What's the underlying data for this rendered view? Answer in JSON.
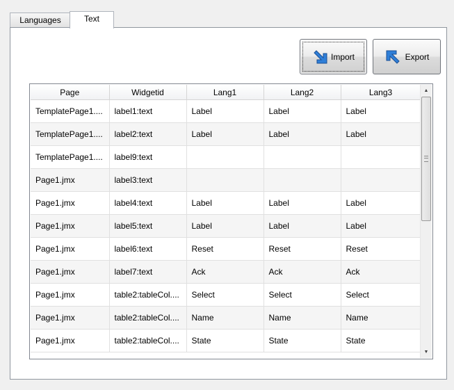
{
  "tabs": [
    {
      "label": "Languages",
      "active": false
    },
    {
      "label": "Text",
      "active": true
    }
  ],
  "buttons": {
    "import_label": "Import",
    "export_label": "Export",
    "import_icon": "arrow-down-right-icon",
    "export_icon": "arrow-up-left-icon"
  },
  "table": {
    "columns": [
      "Page",
      "Widgetid",
      "Lang1",
      "Lang2",
      "Lang3"
    ],
    "rows": [
      [
        "TemplatePage1....",
        "label1:text",
        "Label",
        "Label",
        "Label"
      ],
      [
        "TemplatePage1....",
        "label2:text",
        "Label",
        "Label",
        "Label"
      ],
      [
        "TemplatePage1....",
        "label9:text",
        "",
        "",
        ""
      ],
      [
        "Page1.jmx",
        "label3:text",
        "",
        "",
        ""
      ],
      [
        "Page1.jmx",
        "label4:text",
        "Label",
        "Label",
        "Label"
      ],
      [
        "Page1.jmx",
        "label5:text",
        "Label",
        "Label",
        "Label"
      ],
      [
        "Page1.jmx",
        "label6:text",
        "Reset",
        "Reset",
        "Reset"
      ],
      [
        "Page1.jmx",
        "label7:text",
        "Ack",
        "Ack",
        "Ack"
      ],
      [
        "Page1.jmx",
        "table2:tableCol....",
        "Select",
        "Select",
        "Select"
      ],
      [
        "Page1.jmx",
        "table2:tableCol....",
        "Name",
        "Name",
        "Name"
      ],
      [
        "Page1.jmx",
        "table2:tableCol....",
        "State",
        "State",
        "State"
      ]
    ]
  },
  "scrollbar": {
    "position": 0,
    "visible_fraction": 0.48
  },
  "colors": {
    "arrow_blue": "#2f7fd8",
    "panel_border": "#8f969e"
  }
}
